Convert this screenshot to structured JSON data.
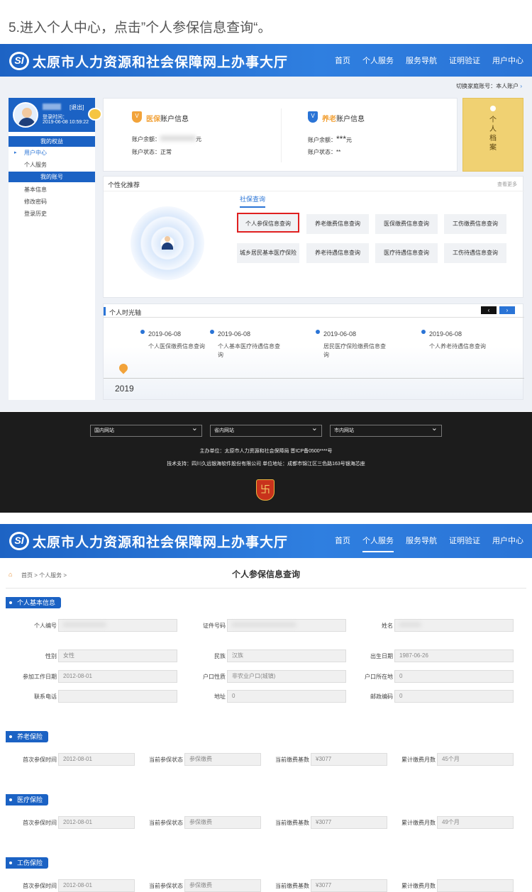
{
  "step_caption": "5.进入个人中心，点击”个人参保信息查询“。",
  "site": {
    "logo_text": "SI",
    "title": "太原市人力资源和社会保障网上办事大厅",
    "nav": [
      "首页",
      "个人服务",
      "服务导航",
      "证明验证",
      "用户中心"
    ]
  },
  "account_switch": "切换家庭账号：本人账户",
  "user": {
    "logout": "[退出]",
    "login_time_label": "登录时间：",
    "login_time": "2019-06-08 10:59:22"
  },
  "sidebar": {
    "sec1": "我的权益",
    "items1": [
      "用户中心",
      "个人服务"
    ],
    "sec2": "我的账号",
    "items2": [
      "基本信息",
      "修改密码",
      "登录历史"
    ]
  },
  "accounts": {
    "medical": {
      "title_hl": "医保",
      "title": "账户信息",
      "balance_label": "账户余额：",
      "balance_unit": "元",
      "status_label": "账户状态：",
      "status": "正常"
    },
    "pension": {
      "title_hl": "养老",
      "title": "账户信息",
      "balance_label": "账户余额：",
      "balance": "***",
      "balance_unit": "元",
      "status_label": "账户状态：",
      "status": "**"
    }
  },
  "archive": {
    "text": "个人档案"
  },
  "recommend": {
    "title": "个性化推荐",
    "more": "查看更多",
    "tab": "社保查询",
    "buttons": [
      "个人参保信息查询",
      "养老缴费信息查询",
      "医保缴费信息查询",
      "工伤缴费信息查询",
      "城乡居民基本医疗保险",
      "养老待遇信息查询",
      "医疗待遇信息查询",
      "工伤待遇信息查询"
    ]
  },
  "timeline": {
    "title": "个人时光轴",
    "year": "2019",
    "events": [
      {
        "date": "2019-06-08",
        "text": "个人医保缴费信息查询"
      },
      {
        "date": "2019-06-08",
        "text": "个人基本医疗待遇信息查询"
      },
      {
        "date": "2019-06-08",
        "text": "居民医疗保险缴费信息查询"
      },
      {
        "date": "2019-06-08",
        "text": "个人养老待遇信息查询"
      }
    ]
  },
  "footer": {
    "selects": [
      "国内网站",
      "省内网站",
      "市内网站"
    ],
    "line1": "主办单位：太原市人力资源和社会保障局 晋ICP备0500****号",
    "line2": "技术支持：四川久远银海软件股份有限公司 单位地址：成都市锦江区三色路163号银海芯座",
    "badge": "卐"
  },
  "detail": {
    "breadcrumb": "首页 > 个人服务 >",
    "title": "个人参保信息查询",
    "basic": {
      "tag": "个人基本信息",
      "fields": [
        {
          "label": "个人编号",
          "value": ""
        },
        {
          "label": "证件号码",
          "value": ""
        },
        {
          "label": "姓名",
          "value": ""
        },
        {
          "label": "性别",
          "value": "女性"
        },
        {
          "label": "民族",
          "value": "汉族"
        },
        {
          "label": "出生日期",
          "value": "1987-06-26"
        },
        {
          "label": "参加工作日期",
          "value": "2012-08-01"
        },
        {
          "label": "户口性质",
          "value": "非农业户口(城镇)"
        },
        {
          "label": "户口所在地",
          "value": "0"
        },
        {
          "label": "联系电话",
          "value": ""
        },
        {
          "label": "地址",
          "value": "0"
        },
        {
          "label": "邮政编码",
          "value": "0"
        }
      ]
    },
    "insurances": [
      {
        "tag": "养老保险",
        "fields": [
          {
            "label": "首次参保时间",
            "value": "2012-08-01"
          },
          {
            "label": "当前参保状态",
            "value": "参保缴费"
          },
          {
            "label": "当前缴费基数",
            "value": "¥3077"
          },
          {
            "label": "累计缴费月数",
            "value": "45个月"
          }
        ]
      },
      {
        "tag": "医疗保险",
        "fields": [
          {
            "label": "首次参保时间",
            "value": "2012-08-01"
          },
          {
            "label": "当前参保状态",
            "value": "参保缴费"
          },
          {
            "label": "当前缴费基数",
            "value": "¥3077"
          },
          {
            "label": "累计缴费月数",
            "value": "49个月"
          }
        ]
      },
      {
        "tag": "工伤保险",
        "fields": [
          {
            "label": "首次参保时间",
            "value": "2012-08-01"
          },
          {
            "label": "当前参保状态",
            "value": "参保缴费"
          },
          {
            "label": "当前缴费基数",
            "value": "¥3077"
          },
          {
            "label": "累计缴费月数",
            "value": ""
          }
        ]
      }
    ]
  }
}
